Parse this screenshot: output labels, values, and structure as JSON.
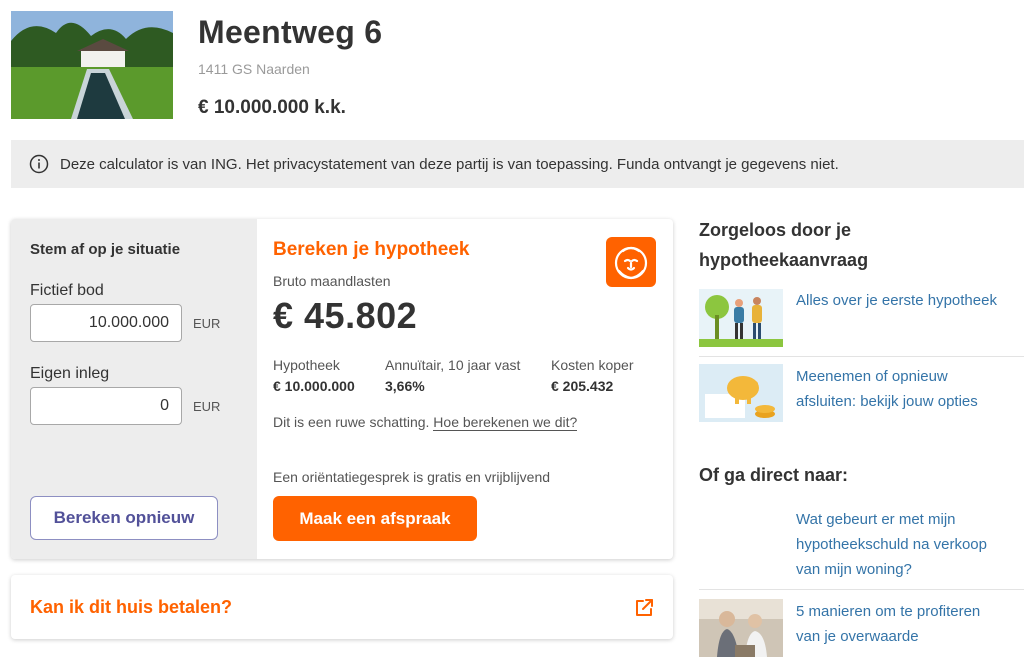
{
  "listing": {
    "title": "Meentweg 6",
    "address": "1411 GS Naarden",
    "price": "€ 10.000.000 k.k."
  },
  "notice": {
    "icon": "info-icon",
    "text": "Deze calculator is van ING. Het privacystatement van deze partij is van toepassing. Funda ontvangt je gegevens niet."
  },
  "calculator": {
    "situation_heading": "Stem af op je situatie",
    "bid_label": "Fictief bod",
    "bid_value": "10.000.000",
    "bid_unit": "EUR",
    "own_label": "Eigen inleg",
    "own_value": "0",
    "own_unit": "EUR",
    "recalc_label": "Bereken opnieuw",
    "heading": "Bereken je hypotheek",
    "monthly_label": "Bruto maandlasten",
    "monthly_value": "€ 45.802",
    "columns": [
      {
        "label": "Hypotheek",
        "value": "€ 10.000.000"
      },
      {
        "label": "Annuïtair, 10 jaar vast",
        "value": "3,66%"
      },
      {
        "label": "Kosten koper",
        "value": "€ 205.432"
      }
    ],
    "estimate_text": "Dit is een ruwe schatting.",
    "estimate_link": "Hoe berekenen we dit?",
    "orientation_text": "Een oriëntatiegesprek is gratis en vrijblijvend",
    "appointment_label": "Maak een afspraak",
    "brand_color": "#ff6200",
    "logo_icon": "ing-lion-icon"
  },
  "afford": {
    "label": "Kan ik dit huis betalen?",
    "icon": "external-link-icon"
  },
  "sidebar": {
    "heading1_line1": "Zorgeloos door je",
    "heading1_line2": "hypotheekaanvraag",
    "article1": "Alles over je eerste hypotheek",
    "article2_line1": "Meenemen of opnieuw",
    "article2_line2": "afsluiten: bekijk jouw opties",
    "heading2": "Of ga direct naar:",
    "article3_line1": "Wat gebeurt er met mijn",
    "article3_line2": "hypotheekschuld na verkoop",
    "article3_line3": "van mijn woning?",
    "article4_line1": "5 manieren om te profiteren",
    "article4_line2": "van je overwaarde",
    "link_color": "#3474a8"
  }
}
